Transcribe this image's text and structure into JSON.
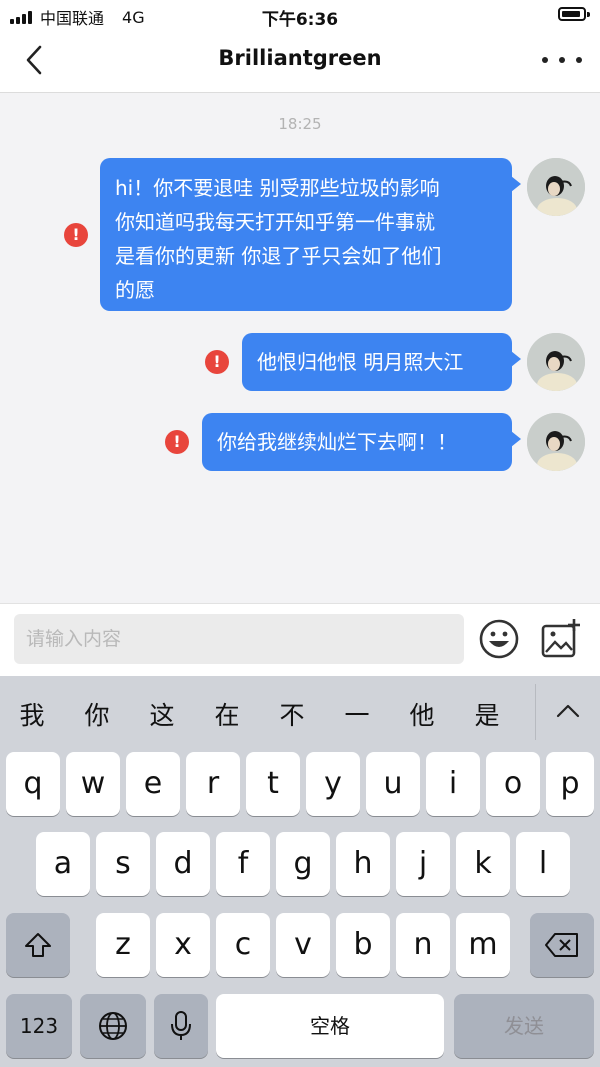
{
  "status_bar": {
    "carrier": "中国联通",
    "network": "4G",
    "time": "下午6:36"
  },
  "nav": {
    "title": "Brilliantgreen",
    "back_icon": "chevron-left-icon",
    "more_icon": "more-dots-icon"
  },
  "chat": {
    "timestamp": "18:25",
    "messages": [
      {
        "lines": [
          "hi！你不要退哇 别受那些垃圾的影响",
          "你知道吗我每天打开知乎第一件事就",
          "是看你的更新 你退了乎只会如了他们",
          "的愿"
        ],
        "status": "failed"
      },
      {
        "lines": [
          "他恨归他恨 明月照大江"
        ],
        "status": "failed"
      },
      {
        "lines": [
          "你给我继续灿烂下去啊！！"
        ],
        "status": "failed"
      }
    ],
    "error_glyph": "!"
  },
  "input": {
    "placeholder": "请输入内容",
    "value": ""
  },
  "keyboard": {
    "candidates": [
      "我",
      "你",
      "这",
      "在",
      "不",
      "一",
      "他",
      "是"
    ],
    "row1": [
      "q",
      "w",
      "e",
      "r",
      "t",
      "y",
      "u",
      "i",
      "o",
      "p"
    ],
    "row2": [
      "a",
      "s",
      "d",
      "f",
      "g",
      "h",
      "j",
      "k",
      "l"
    ],
    "row3": [
      "z",
      "x",
      "c",
      "v",
      "b",
      "n",
      "m"
    ],
    "numbers_label": "123",
    "space_label": "空格",
    "send_label": "发送"
  },
  "colors": {
    "bubble": "#3d84f1",
    "error": "#e8453c",
    "keyboard_bg": "#d0d3d9"
  }
}
